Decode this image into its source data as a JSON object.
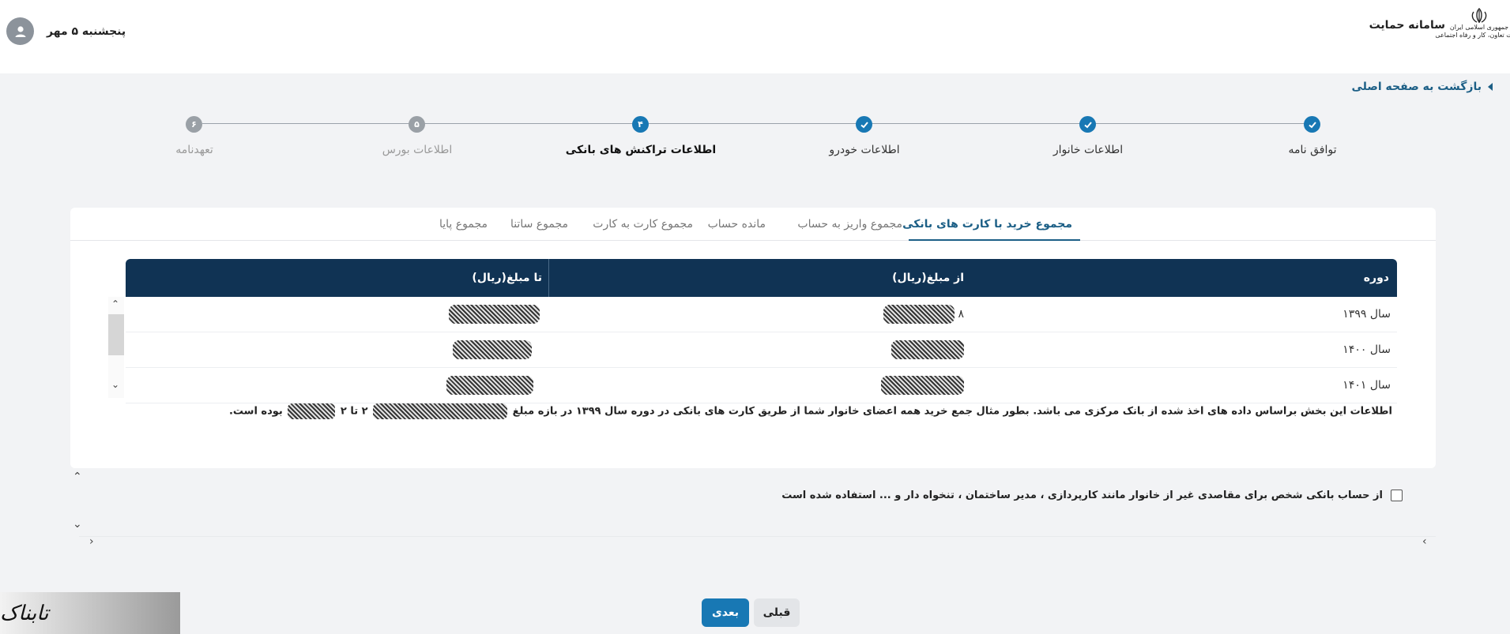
{
  "header": {
    "app_title": "سامانه حمایت",
    "ministry_text": "وزارت تعاون، کار و رفاه اجتماعی",
    "ministry_top": "جمهوری اسلامی ایران",
    "user_date": "پنجشنبه ۵ مهر"
  },
  "back_link": "بازگشت به صفحه اصلی",
  "stepper": {
    "steps": [
      {
        "number": "",
        "label": "توافق نامه",
        "state": "done"
      },
      {
        "number": "",
        "label": "اطلاعات خانوار",
        "state": "done"
      },
      {
        "number": "",
        "label": "اطلاعات خودرو",
        "state": "done"
      },
      {
        "number": "۴",
        "label": "اطلاعات تراکنش های بانکی",
        "state": "active"
      },
      {
        "number": "۵",
        "label": "اطلاعات بورس",
        "state": "todo"
      },
      {
        "number": "۶",
        "label": "تعهدنامه",
        "state": "todo"
      }
    ]
  },
  "tabs": [
    {
      "label": "مجموع خرید با کارت های بانکی",
      "active": true
    },
    {
      "label": "مجموع واریز به حساب",
      "active": false
    },
    {
      "label": "مانده حساب",
      "active": false
    },
    {
      "label": "مجموع کارت به کارت",
      "active": false
    },
    {
      "label": "مجموع ساتنا",
      "active": false
    },
    {
      "label": "مجموع پایا",
      "active": false
    }
  ],
  "table": {
    "headers": [
      "دوره",
      "از مبلغ(ریال)",
      "تا مبلغ(ریال)"
    ],
    "rows": [
      {
        "period": "سال ۱۳۹۹",
        "from_suffix": "۸"
      },
      {
        "period": "سال ۱۴۰۰",
        "from_suffix": ""
      },
      {
        "period": "سال ۱۴۰۱",
        "from_suffix": ""
      }
    ]
  },
  "note": {
    "before": "اطلاعات این بخش براساس داده های اخذ شده از بانک مرکزی می باشد. بطور مثال جمع خرید همه اعضای خانوار شما از طریق کارت های بانکی در دوره سال ۱۳۹۹ در بازه مبلغ",
    "middle": "۲ تا ۲",
    "after": "بوده است."
  },
  "checkbox_label": "از حساب بانکی شخص برای مقاصدی غیر از خانوار مانند کارپردازی ، مدیر ساختمان ، تنخواه دار و ... استفاده شده است",
  "buttons": {
    "next": "بعدی",
    "prev": "قبلی"
  },
  "watermark": "تابناک",
  "colors": {
    "primary": "#1878b4",
    "table_header": "#103354",
    "link": "#1c5f86"
  }
}
